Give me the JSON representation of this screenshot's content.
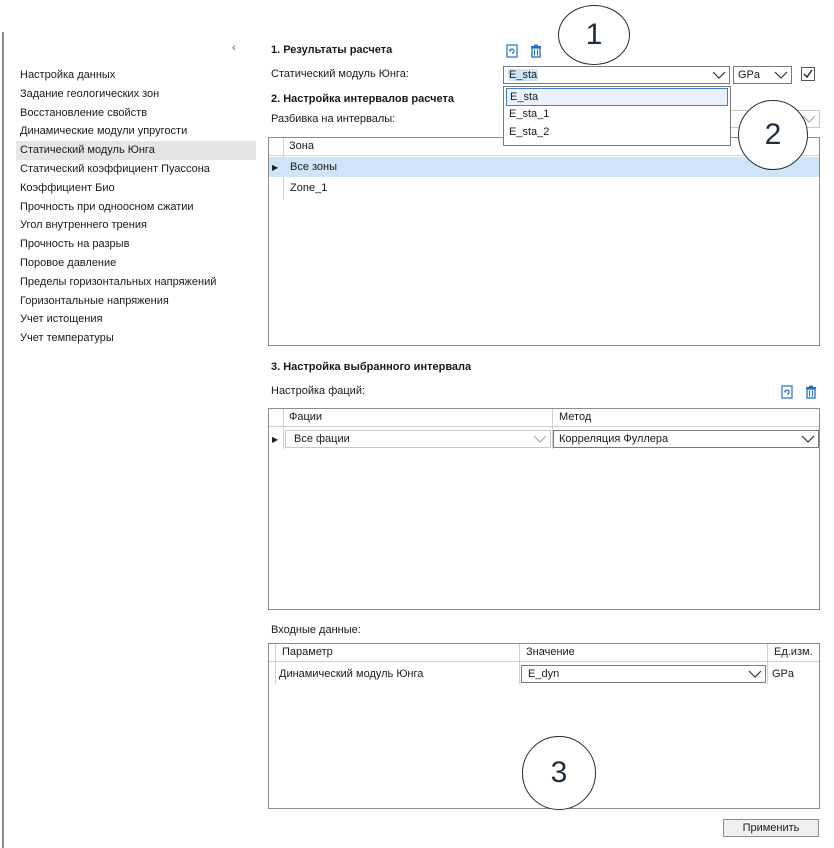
{
  "sidebar": {
    "collapse_glyph": "‹",
    "items": [
      {
        "label": "Настройка данных"
      },
      {
        "label": "Задание геологических зон"
      },
      {
        "label": "Восстановление свойств"
      },
      {
        "label": "Динамические модули упругости"
      },
      {
        "label": "Статический модуль Юнга"
      },
      {
        "label": "Статический коэффициент Пуассона"
      },
      {
        "label": "Коэффициент Био"
      },
      {
        "label": "Прочность при одноосном сжатии"
      },
      {
        "label": "Угол внутреннего трения"
      },
      {
        "label": "Прочность на разрыв"
      },
      {
        "label": "Поровое давление"
      },
      {
        "label": "Пределы горизонтальных напряжений"
      },
      {
        "label": "Горизонтальные напряжения"
      },
      {
        "label": "Учет истощения"
      },
      {
        "label": "Учет температуры"
      }
    ]
  },
  "section1": {
    "title": "1. Результаты расчета",
    "field_label": "Статический модуль Юнга:",
    "selected_value": "E_sta",
    "unit_value": "GPa",
    "dropdown_options": [
      "E_sta",
      "E_sta_1",
      "E_sta_2"
    ]
  },
  "section2": {
    "title": "2. Настройка интервалов расчета",
    "field_label": "Разбивка на интервалы:",
    "grid": {
      "header": "Зона",
      "rows": [
        "Все зоны",
        "Zone_1"
      ]
    }
  },
  "section3": {
    "title": "3. Настройка выбранного интервала",
    "facies_label": "Настройка фаций:",
    "facies_grid": {
      "headers": [
        "Фации",
        "Метод"
      ],
      "rows": [
        {
          "facies": "Все фации",
          "method": "Корреляция Фуллера"
        }
      ]
    },
    "input_label": "Входные данные:",
    "input_grid": {
      "headers": [
        "Параметр",
        "Значение",
        "Ед.изм."
      ],
      "rows": [
        {
          "param": "Динамический модуль Юнга",
          "value": "E_dyn",
          "unit": "GPa"
        }
      ]
    }
  },
  "apply_label": "Применить",
  "callouts": [
    "1",
    "2",
    "3"
  ],
  "row_marker": "▶",
  "colors": {
    "accent_icon": "#1c6fc8",
    "selection": "#cfe3f9",
    "callout_border": "#1f2d3d"
  }
}
